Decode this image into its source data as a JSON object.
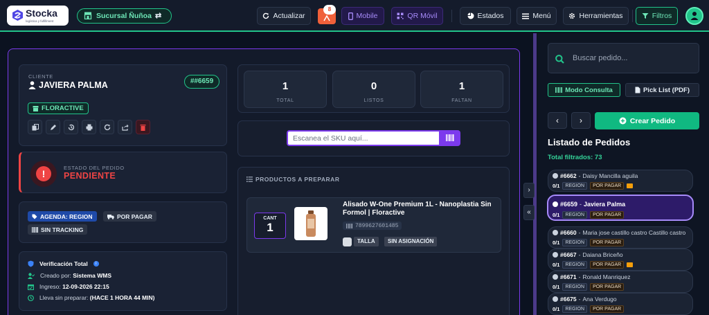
{
  "app": {
    "logo_name": "Stocka",
    "logo_tagline": "logística y fulfillment"
  },
  "topbar": {
    "branch": "Sucursal Ñuñoa",
    "refresh_label": "Actualizar",
    "notif_count": "8",
    "mobile_label": "Mobile",
    "qr_label": "QR Móvil",
    "states_label": "Estados",
    "menu_label": "Menú",
    "tools_label": "Herramientas",
    "filters_label": "Filtros"
  },
  "client": {
    "label": "CLIENTE",
    "name": "JAVIERA PALMA",
    "order_number": "##6659",
    "brand": "FLORACTIVE"
  },
  "status": {
    "label": "ESTADO DEL PEDIDO",
    "value": "PENDIENTE"
  },
  "tags": {
    "agenda": "AGENDA: REGION",
    "payment": "POR PAGAR",
    "tracking": "SIN TRACKING"
  },
  "info": {
    "verification": "Verificación Total",
    "created_by_label": "Creado por:",
    "created_by": "Sistema WMS",
    "entry_label": "Ingreso:",
    "entry": "12-09-2026 22:15",
    "waiting_label": "Lleva sin preparar:",
    "waiting": "(HACE 1 HORA 44 MIN)"
  },
  "stats": [
    {
      "value": "1",
      "label": "TOTAL"
    },
    {
      "value": "0",
      "label": "LISTOS"
    },
    {
      "value": "1",
      "label": "FALTAN"
    }
  ],
  "scan": {
    "placeholder": "Escanea el SKU aquí..."
  },
  "products": {
    "heading": "PRODUCTOS A PREPARAR",
    "cant_label": "CANT",
    "cant_value": "1",
    "name": "Alisado W-One Premium 1L - Nanoplastia Sin Formol | Floractive",
    "sku": "7899627601485",
    "size_tag": "TALLA",
    "assign_tag": "SIN ASIGNACIÓN"
  },
  "sidebar": {
    "search_placeholder": "Buscar pedido...",
    "mode_label": "Modo Consulta",
    "pick_label": "Pick List (PDF)",
    "prev": "‹",
    "next": "›",
    "create_label": "Crear Pedido",
    "list_title": "Listado de Pedidos",
    "total_filtered": "Total filtrados: 73"
  },
  "orders": [
    {
      "number": "#6662",
      "name": "Daisy Mancilla aguila",
      "qty": "0/1",
      "region": "REGION",
      "payment": "POR PAGAR",
      "active": false
    },
    {
      "number": "#6659",
      "name": "Javiera Palma",
      "qty": "0/1",
      "region": "REGION",
      "payment": "POR PAGAR",
      "active": true
    },
    {
      "number": "#6660",
      "name": "Maria jose castillo castro Castillo castro",
      "qty": "0/1",
      "region": "REGION",
      "payment": "POR PAGAR",
      "active": false
    },
    {
      "number": "#6667",
      "name": "Daiana Briceño",
      "qty": "0/1",
      "region": "REGION",
      "payment": "POR PAGAR",
      "active": false
    },
    {
      "number": "#6671",
      "name": "Ronald Manriquez",
      "qty": "0/1",
      "region": "REGION",
      "payment": "POR PAGAR",
      "active": false
    },
    {
      "number": "#6675",
      "name": "Ana Verdugo",
      "qty": "0/1",
      "region": "REGION",
      "payment": "POR PAGAR",
      "active": false
    }
  ]
}
